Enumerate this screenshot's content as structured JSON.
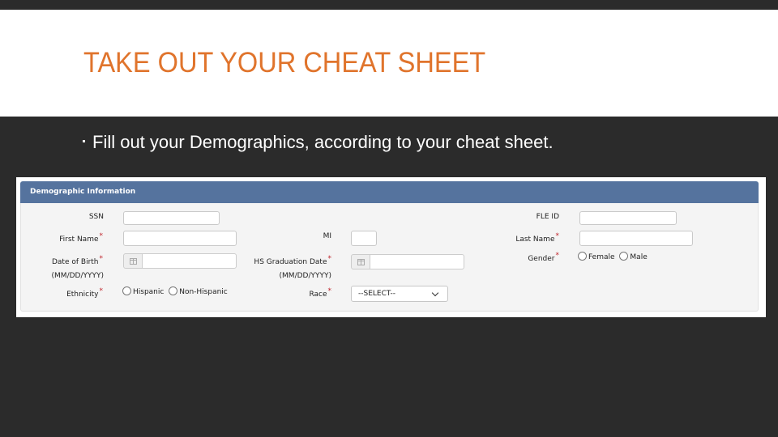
{
  "slide": {
    "title": "TAKE OUT YOUR CHEAT SHEET",
    "bullet": "Fill out your Demographics, according to your cheat sheet."
  },
  "form": {
    "header": "Demographic Information",
    "required_mark": "*",
    "fields": {
      "ssn": {
        "label": "SSN",
        "value": ""
      },
      "fle_id": {
        "label": "FLE ID",
        "value": ""
      },
      "first_name": {
        "label": "First Name",
        "value": ""
      },
      "mi": {
        "label": "MI",
        "value": ""
      },
      "last_name": {
        "label": "Last Name",
        "value": ""
      },
      "dob": {
        "label": "Date of Birth",
        "format": "(MM/DD/YYYY)",
        "value": ""
      },
      "hs_grad": {
        "label": "HS Graduation Date",
        "format": "(MM/DD/YYYY)",
        "value": ""
      },
      "gender": {
        "label": "Gender",
        "options": [
          "Female",
          "Male"
        ]
      },
      "ethnicity": {
        "label": "Ethnicity",
        "options": [
          "Hispanic",
          "Non-Hispanic"
        ]
      },
      "race": {
        "label": "Race",
        "selected": "--SELECT--"
      }
    }
  },
  "colors": {
    "title": "#e0742c",
    "header_bar": "#55739e",
    "required": "#c0262d",
    "background": "#2b2b2b"
  }
}
